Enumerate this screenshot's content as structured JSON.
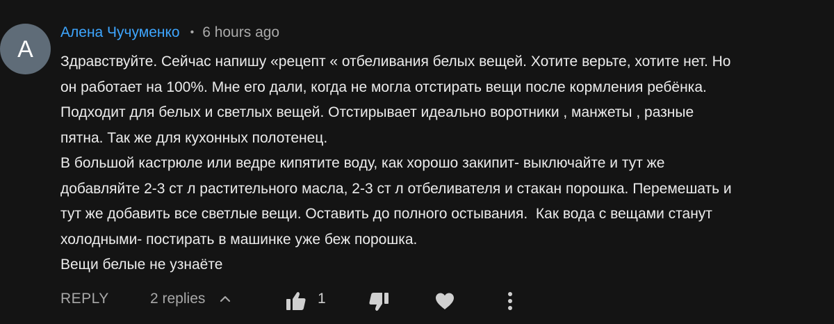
{
  "comment": {
    "avatar_letter": "А",
    "author": "Алена Чучуменко",
    "separator": "•",
    "time": "6 hours ago",
    "lines": [
      "Здравствуйте. Сейчас напишу «рецепт « отбеливания белых вещей. Хотите верьте, хотите нет. Но",
      "он работает на 100%. Мне его дали, когда не могла отстирать вещи после кормления ребёнка.",
      "Подходит для белых и светлых вещей. Отстирывает идеально воротники , манжеты , разные",
      "пятна. Так же для кухонных полотенец.",
      "В большой кастрюле или ведре кипятите воду, как хорошо закипит- выключайте и тут же",
      "добавляйте 2-3 ст л растительного масла, 2-3 ст л отбеливателя и стакан порошка. Перемешать и",
      "тут же добавить все светлые вещи. Оставить до полного остывания.  Как вода с вещами станут",
      "холодными- постирать в машинке уже беж порошка.",
      "Вещи белые не узнаёте"
    ]
  },
  "actions": {
    "reply_label": "REPLY",
    "replies_label": "2 replies",
    "like_count": "1",
    "icons": [
      "chevron-up-icon",
      "thumbs-up-icon",
      "thumbs-down-icon",
      "heart-icon",
      "more-vertical-icon"
    ]
  },
  "colors": {
    "background": "#141414",
    "author": "#3ea6ff",
    "text": "#ececec",
    "muted": "#aaaaaa",
    "avatar": "#5f6c78"
  }
}
